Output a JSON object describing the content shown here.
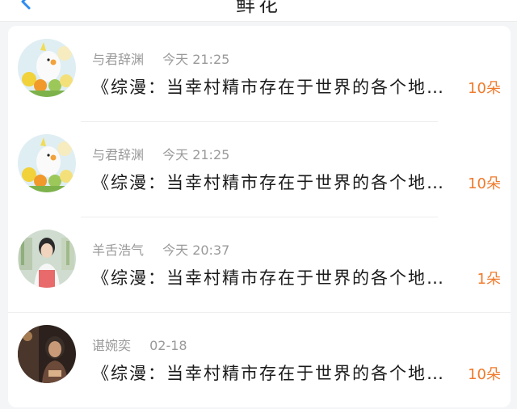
{
  "header": {
    "title": "鲜花"
  },
  "messages": [
    {
      "user": "与君辞渊",
      "time": "今天 21:25",
      "preview": "《综漫：当幸村精市存在于世界的各个地…",
      "count": "10朵",
      "avatar": "cockatiel-avatar"
    },
    {
      "user": "与君辞渊",
      "time": "今天 21:25",
      "preview": "《综漫：当幸村精市存在于世界的各个地…",
      "count": "10朵",
      "avatar": "cockatiel-avatar"
    },
    {
      "user": "羊舌浩气",
      "time": "今天 20:37",
      "preview": "《综漫：当幸村精市存在于世界的各个地…",
      "count": "1朵",
      "avatar": "girl-photo-avatar"
    },
    {
      "user": "谌婉奕",
      "time": "02-18",
      "preview": "《综漫：当幸村精市存在于世界的各个地…",
      "count": "10朵",
      "avatar": "dark-photo-avatar"
    }
  ],
  "colors": {
    "accent_count": "#f07a2b",
    "back_icon": "#2d8cf0"
  }
}
